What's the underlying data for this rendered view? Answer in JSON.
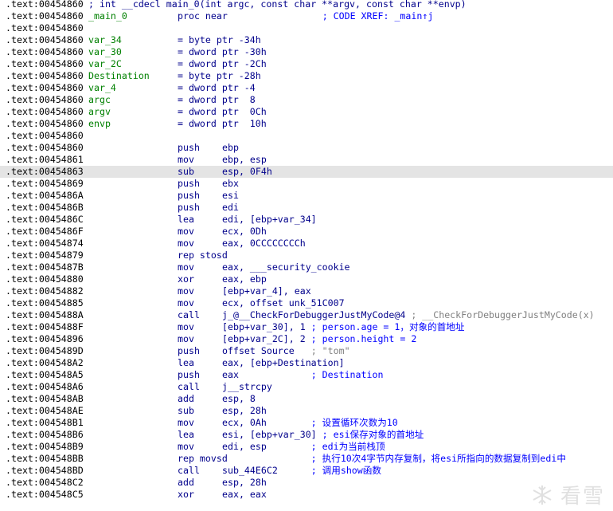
{
  "listing": [
    {
      "addr": ".text:00454860",
      "full": "; int __cdecl main_0(int argc, const char **argv, const char **envp)"
    },
    {
      "addr": ".text:00454860",
      "label": "_main_0",
      "mnem": "proc near",
      "opnd": "",
      "cmt": "               ; CODE XREF: _main↑j",
      "cmt_gap": true
    },
    {
      "addr": ".text:00454860"
    },
    {
      "addr": ".text:00454860",
      "label": "var_34",
      "mnem": "= byte ptr -34h"
    },
    {
      "addr": ".text:00454860",
      "label": "var_30",
      "mnem": "= dword ptr -30h"
    },
    {
      "addr": ".text:00454860",
      "label": "var_2C",
      "mnem": "= dword ptr -2Ch"
    },
    {
      "addr": ".text:00454860",
      "label": "Destination",
      "mnem": "= byte ptr -28h"
    },
    {
      "addr": ".text:00454860",
      "label": "var_4",
      "mnem": "= dword ptr -4"
    },
    {
      "addr": ".text:00454860",
      "label": "argc",
      "mnem": "= dword ptr  8"
    },
    {
      "addr": ".text:00454860",
      "label": "argv",
      "mnem": "= dword ptr  0Ch"
    },
    {
      "addr": ".text:00454860",
      "label": "envp",
      "mnem": "= dword ptr  10h"
    },
    {
      "addr": ".text:00454860"
    },
    {
      "addr": ".text:00454860",
      "mnem": "push",
      "opnd": "ebp"
    },
    {
      "addr": ".text:00454861",
      "mnem": "mov",
      "opnd": "ebp, esp"
    },
    {
      "addr": ".text:00454863",
      "mnem": "sub",
      "opnd": "esp, 0F4h",
      "selected": true
    },
    {
      "addr": ".text:00454869",
      "mnem": "push",
      "opnd": "ebx"
    },
    {
      "addr": ".text:0045486A",
      "mnem": "push",
      "opnd": "esi"
    },
    {
      "addr": ".text:0045486B",
      "mnem": "push",
      "opnd": "edi"
    },
    {
      "addr": ".text:0045486C",
      "mnem": "lea",
      "opnd": "edi, [ebp+var_34]"
    },
    {
      "addr": ".text:0045486F",
      "mnem": "mov",
      "opnd": "ecx, 0Dh"
    },
    {
      "addr": ".text:00454874",
      "mnem": "mov",
      "opnd": "eax, 0CCCCCCCCh"
    },
    {
      "addr": ".text:00454879",
      "mnem": "rep stosd",
      "opnd": ""
    },
    {
      "addr": ".text:0045487B",
      "mnem": "mov",
      "opnd": "eax, ___security_cookie"
    },
    {
      "addr": ".text:00454880",
      "mnem": "xor",
      "opnd": "eax, ebp"
    },
    {
      "addr": ".text:00454882",
      "mnem": "mov",
      "opnd": "[ebp+var_4], eax"
    },
    {
      "addr": ".text:00454885",
      "mnem": "mov",
      "opnd": "ecx, offset unk_51C007"
    },
    {
      "addr": ".text:0045488A",
      "mnem": "call",
      "opnd": "j_@__CheckForDebuggerJustMyCode@4",
      "cmt": " ; __CheckForDebuggerJustMyCode(x)",
      "cmt_gray": true
    },
    {
      "addr": ".text:0045488F",
      "mnem": "mov",
      "opnd": "[ebp+var_30], 1",
      "cmt": " ; person.age = 1，对象的首地址"
    },
    {
      "addr": ".text:00454896",
      "mnem": "mov",
      "opnd": "[ebp+var_2C], 2",
      "cmt": " ; person.height = 2"
    },
    {
      "addr": ".text:0045489D",
      "mnem": "push",
      "opnd": "offset Source",
      "cmt": "   ; \"tom\"",
      "cmt_gray": true
    },
    {
      "addr": ".text:004548A2",
      "mnem": "lea",
      "opnd": "eax, [ebp+Destination]"
    },
    {
      "addr": ".text:004548A5",
      "mnem": "push",
      "opnd": "eax",
      "cmt": "             ; Destination"
    },
    {
      "addr": ".text:004548A6",
      "mnem": "call",
      "opnd": "j__strcpy"
    },
    {
      "addr": ".text:004548AB",
      "mnem": "add",
      "opnd": "esp, 8"
    },
    {
      "addr": ".text:004548AE",
      "mnem": "sub",
      "opnd": "esp, 28h"
    },
    {
      "addr": ".text:004548B1",
      "mnem": "mov",
      "opnd": "ecx, 0Ah",
      "cmt": "        ; 设置循环次数为10"
    },
    {
      "addr": ".text:004548B6",
      "mnem": "lea",
      "opnd": "esi, [ebp+var_30]",
      "cmt": " ; esi保存对象的首地址"
    },
    {
      "addr": ".text:004548B9",
      "mnem": "mov",
      "opnd": "edi, esp",
      "cmt": "        ; edi为当前栈顶"
    },
    {
      "addr": ".text:004548BB",
      "mnem": "rep movsd",
      "opnd": "",
      "cmt": "                ; 执行10次4字节内存复制，将esi所指向的数据复制到edi中",
      "cmt_wide": true
    },
    {
      "addr": ".text:004548BD",
      "mnem": "call",
      "opnd": "sub_44E6C2",
      "cmt": "      ; 调用show函数"
    },
    {
      "addr": ".text:004548C2",
      "mnem": "add",
      "opnd": "esp, 28h"
    },
    {
      "addr": ".text:004548C5",
      "mnem": "xor",
      "opnd": "eax, eax"
    }
  ],
  "watermark": {
    "text": "看雪",
    "icon": "snowflake-logo-icon"
  }
}
